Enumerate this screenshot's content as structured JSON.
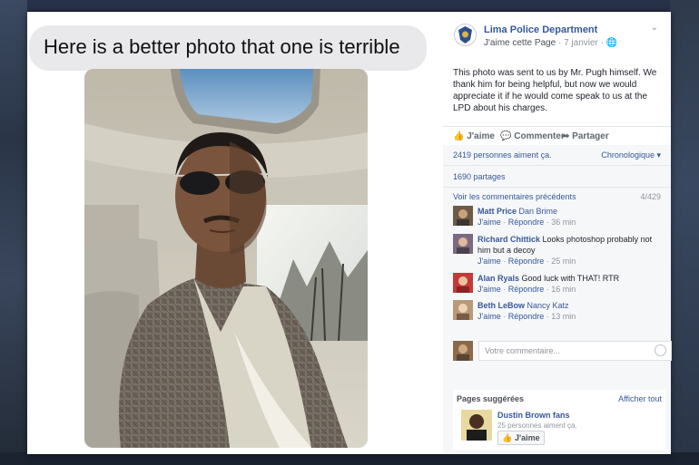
{
  "photo_caption": "Here is a better photo that one is terrible",
  "post": {
    "page_name": "Lima Police Department",
    "like_page": "J'aime cette Page",
    "separator": "·",
    "date": "7 janvier",
    "privacy_icon": "globe-icon",
    "body": "This photo was sent to us by Mr. Pugh himself. We thank him for being helpful, but now we would appreciate it if he would come speak to us at the LPD about his charges."
  },
  "actions": {
    "like": "J'aime",
    "comment": "Commenter",
    "share": "Partager"
  },
  "stats": {
    "likes": "2419 personnes aiment ça.",
    "order": "Chronologique",
    "shares": "1690 partages",
    "previous_comments": "Voir les commentaires précédents",
    "count": "4/429"
  },
  "comments": [
    {
      "name": "Matt Price",
      "tag": "Dan Brime",
      "text": "",
      "like": "J'aime",
      "reply": "Répondre",
      "time": "36 min"
    },
    {
      "name": "Richard Chittick",
      "tag": "",
      "text": "Looks photoshop probably not him but a decoy",
      "like": "J'aime",
      "reply": "Répondre",
      "time": "25 min"
    },
    {
      "name": "Alan Ryals",
      "tag": "",
      "text": "Good luck with THAT! RTR",
      "like": "J'aime",
      "reply": "Répondre",
      "time": "16 min"
    },
    {
      "name": "Beth LeBow",
      "tag": "Nancy Katz",
      "text": "",
      "like": "J'aime",
      "reply": "Répondre",
      "time": "13 min"
    }
  ],
  "compose": {
    "placeholder": "Votre commentaire..."
  },
  "suggested": {
    "title": "Pages suggérées",
    "see_all": "Afficher tout",
    "name": "Dustin Brown fans",
    "sub": "25 personnes aiment ça.",
    "button": "J'aime"
  },
  "colors": {
    "link": "#365899",
    "muted": "#90949c",
    "feedback_bg": "#f6f7f9",
    "bubble": "#e9e9eb"
  }
}
